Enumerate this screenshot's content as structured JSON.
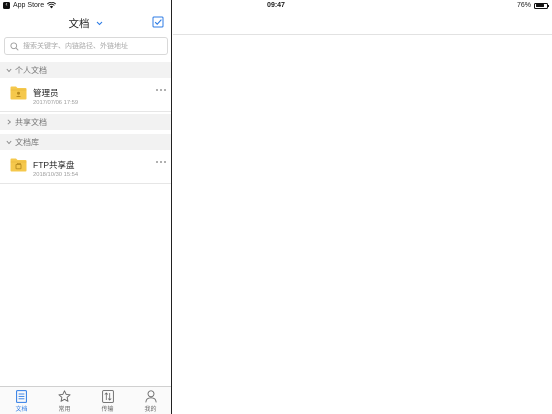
{
  "status_bar": {
    "back_app": "App Store",
    "time": "09:47",
    "battery": "76%",
    "battery_level": 0.76
  },
  "nav": {
    "title": "文档"
  },
  "search": {
    "placeholder": "搜索关键字、内链路径、外链地址"
  },
  "sections": [
    {
      "label": "个人文档",
      "expanded": true
    },
    {
      "label": "共享文档",
      "expanded": false
    },
    {
      "label": "文档库",
      "expanded": true
    }
  ],
  "items": [
    {
      "name": "管理员",
      "time": "2017/07/06 17:59",
      "icon": "user-folder-icon"
    },
    {
      "name": "FTP共享盘",
      "time": "2018/10/30 15:54",
      "icon": "shared-folder-icon"
    }
  ],
  "tabs": [
    {
      "label": "文档",
      "icon": "document-icon",
      "active": true
    },
    {
      "label": "常用",
      "icon": "star-icon",
      "active": false
    },
    {
      "label": "传输",
      "icon": "transfer-icon",
      "active": false
    },
    {
      "label": "我的",
      "icon": "person-icon",
      "active": false
    }
  ],
  "colors": {
    "accent": "#2c7be5",
    "folder": "#f5c84c",
    "section_bg": "#f2f2f2"
  }
}
